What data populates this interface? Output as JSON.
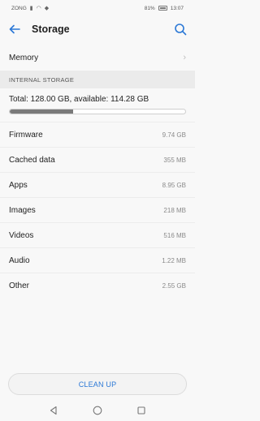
{
  "status_bar": {
    "carrier": "ZONG",
    "battery": "81%",
    "time": "13:07"
  },
  "header": {
    "title": "Storage"
  },
  "memory": {
    "label": "Memory"
  },
  "section": {
    "title": "INTERNAL STORAGE"
  },
  "storage": {
    "total_text": "Total: 128.00 GB, available: 114.28 GB",
    "used_fraction": 0.36
  },
  "items": [
    {
      "label": "Firmware",
      "value": "9.74 GB"
    },
    {
      "label": "Cached data",
      "value": "355 MB"
    },
    {
      "label": "Apps",
      "value": "8.95 GB"
    },
    {
      "label": "Images",
      "value": "218 MB"
    },
    {
      "label": "Videos",
      "value": "516 MB"
    },
    {
      "label": "Audio",
      "value": "1.22 MB"
    },
    {
      "label": "Other",
      "value": "2.55 GB"
    }
  ],
  "actions": {
    "clean_up": "CLEAN UP"
  },
  "colors": {
    "accent": "#2b78d6"
  },
  "icons": {
    "back": "arrow-left-icon",
    "search": "search-icon",
    "memory_chevron": "chevron-right-icon",
    "nav_back": "triangle-back-icon",
    "nav_home": "circle-home-icon",
    "nav_recent": "square-recent-icon"
  }
}
